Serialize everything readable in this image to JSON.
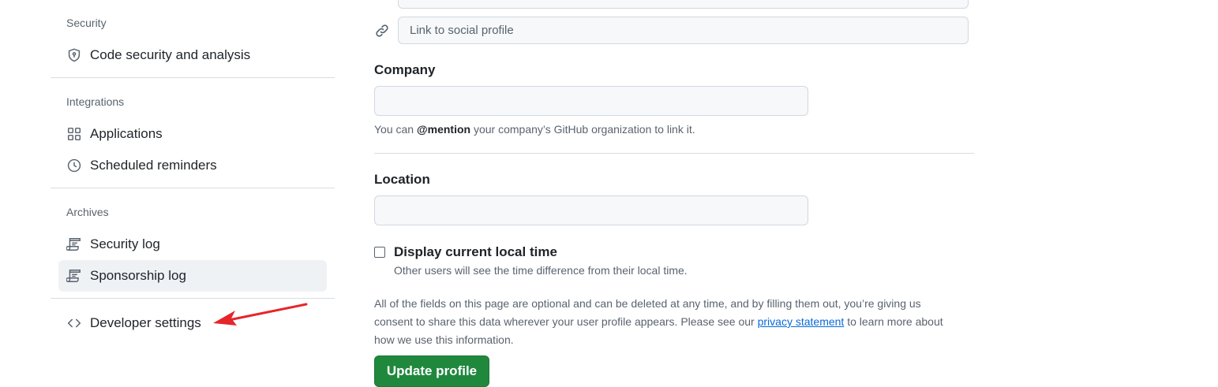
{
  "sidebar": {
    "groups": [
      {
        "heading": "Security",
        "items": [
          {
            "label": "Code security and analysis",
            "icon": "shield-lock-icon"
          }
        ]
      },
      {
        "heading": "Integrations",
        "items": [
          {
            "label": "Applications",
            "icon": "apps-grid-icon"
          },
          {
            "label": "Scheduled reminders",
            "icon": "clock-icon"
          }
        ]
      },
      {
        "heading": "Archives",
        "items": [
          {
            "label": "Security log",
            "icon": "log-icon"
          },
          {
            "label": "Sponsorship log",
            "icon": "log-icon",
            "active": true
          }
        ]
      }
    ],
    "developer_settings": {
      "label": "Developer settings",
      "icon": "code-icon"
    }
  },
  "annotation": {
    "arrow_color": "#e5252a"
  },
  "form": {
    "social_link_placeholder": "Link to social profile",
    "company": {
      "label": "Company",
      "value": "",
      "note_prefix": "You can ",
      "note_mention": "@mention",
      "note_suffix": " your company’s GitHub organization to link it."
    },
    "location": {
      "label": "Location",
      "value": ""
    },
    "local_time": {
      "label": "Display current local time",
      "checked": false,
      "note": "Other users will see the time difference from their local time."
    },
    "disclaimer": {
      "before_link": "All of the fields on this page are optional and can be deleted at any time, and by filling them out, you’re giving us consent to share this data wherever your user profile appears. Please see our ",
      "link": "privacy statement",
      "after_link": " to learn more about how we use this information."
    },
    "submit_label": "Update profile"
  },
  "colors": {
    "primary_button": "#1f883d",
    "link": "#0969da",
    "active_nav_bg": "#eff2f5"
  }
}
